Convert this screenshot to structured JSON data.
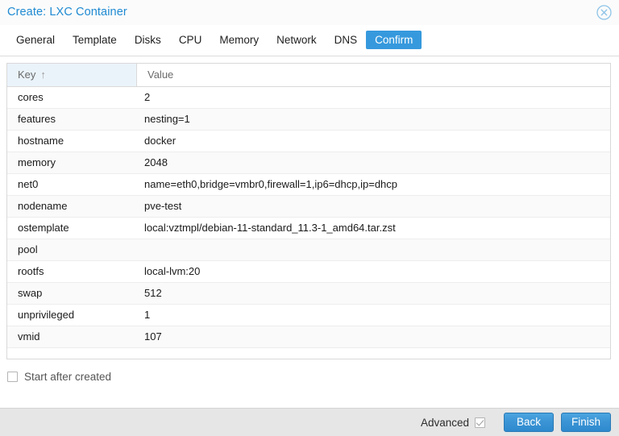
{
  "window": {
    "title": "Create: LXC Container",
    "close_icon": "close-circle-icon"
  },
  "tabs": [
    {
      "label": "General",
      "active": false
    },
    {
      "label": "Template",
      "active": false
    },
    {
      "label": "Disks",
      "active": false
    },
    {
      "label": "CPU",
      "active": false
    },
    {
      "label": "Memory",
      "active": false
    },
    {
      "label": "Network",
      "active": false
    },
    {
      "label": "DNS",
      "active": false
    },
    {
      "label": "Confirm",
      "active": true
    }
  ],
  "grid": {
    "columns": [
      {
        "label": "Key",
        "sort": "asc",
        "sort_glyph": "↑"
      },
      {
        "label": "Value",
        "sort": "none",
        "sort_glyph": ""
      }
    ],
    "rows": [
      {
        "key": "cores",
        "value": "2"
      },
      {
        "key": "features",
        "value": "nesting=1"
      },
      {
        "key": "hostname",
        "value": "docker"
      },
      {
        "key": "memory",
        "value": "2048"
      },
      {
        "key": "net0",
        "value": "name=eth0,bridge=vmbr0,firewall=1,ip6=dhcp,ip=dhcp"
      },
      {
        "key": "nodename",
        "value": "pve-test"
      },
      {
        "key": "ostemplate",
        "value": "local:vztmpl/debian-11-standard_11.3-1_amd64.tar.zst"
      },
      {
        "key": "pool",
        "value": ""
      },
      {
        "key": "rootfs",
        "value": "local-lvm:20"
      },
      {
        "key": "swap",
        "value": "512"
      },
      {
        "key": "unprivileged",
        "value": "1"
      },
      {
        "key": "vmid",
        "value": "107"
      }
    ]
  },
  "options": {
    "start_after_created": {
      "label": "Start after created",
      "checked": false
    }
  },
  "footer": {
    "advanced": {
      "label": "Advanced",
      "checked": true
    },
    "back_label": "Back",
    "finish_label": "Finish"
  },
  "colors": {
    "accent": "#3699dd",
    "title": "#1f8ad2",
    "header_key_bg": "#eaf3fa",
    "footer_bg": "#e6e6e6",
    "row_alt_bg": "#fafafa"
  }
}
